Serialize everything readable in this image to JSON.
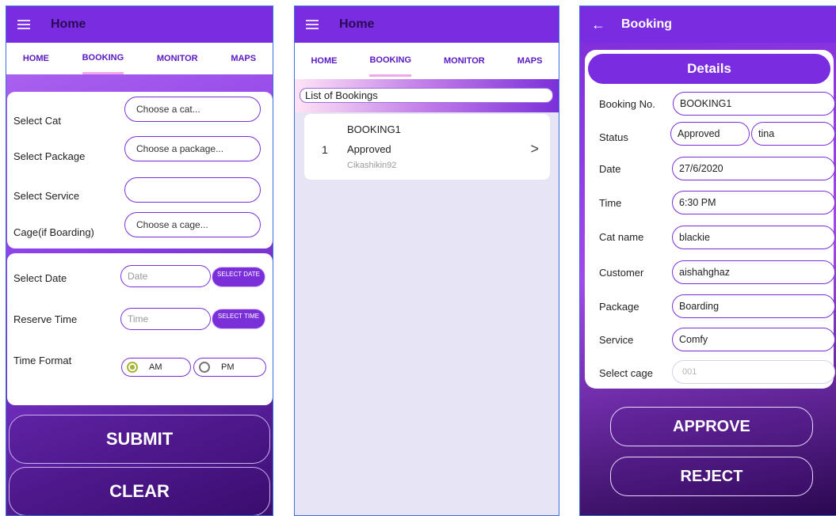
{
  "screen1": {
    "appbar": {
      "title": "Home"
    },
    "tabs": [
      "HOME",
      "BOOKING",
      "MONITOR",
      "MAPS"
    ],
    "active_tab": 1,
    "form": {
      "cat_label": "Select Cat",
      "cat_placeholder": "Choose a cat...",
      "package_label": "Select Package",
      "package_placeholder": "Choose a package...",
      "service_label": "Select Service",
      "service_value": "",
      "cage_label": "Cage(if Boarding)",
      "cage_placeholder": "Choose a cage..."
    },
    "schedule": {
      "date_label": "Select Date",
      "date_placeholder": "Date",
      "select_date_btn": "SELECT DATE",
      "time_label": "Reserve Time",
      "time_placeholder": "Time",
      "select_time_btn": "SELECT TIME",
      "format_label": "Time Format",
      "am_label": "AM",
      "pm_label": "PM",
      "selected_format": "AM"
    },
    "submit_label": "SUBMIT",
    "clear_label": "CLEAR"
  },
  "screen2": {
    "appbar": {
      "title": "Home"
    },
    "tabs": [
      "HOME",
      "BOOKING",
      "MONITOR",
      "MAPS"
    ],
    "active_tab": 1,
    "list_header": "List of Bookings",
    "bookings": [
      {
        "index": "1",
        "booking_no": "BOOKING1",
        "status": "Approved",
        "user": "Cikashikin92"
      }
    ],
    "arrow": ">"
  },
  "screen3": {
    "appbar": {
      "title": "Booking"
    },
    "details_title": "Details",
    "fields": {
      "booking_no_label": "Booking No.",
      "booking_no": "BOOKING1",
      "status_label": "Status",
      "status": "Approved",
      "staff": "tina",
      "date_label": "Date",
      "date": "27/6/2020",
      "time_label": "Time",
      "time": "6:30 PM",
      "cat_label": "Cat name",
      "cat": "blackie",
      "customer_label": "Customer",
      "customer": "aishahghaz",
      "package_label": "Package",
      "package": "Boarding",
      "service_label": "Service",
      "service": "Comfy",
      "cage_label": "Select cage",
      "cage_placeholder": "001"
    },
    "approve_label": "APPROVE",
    "reject_label": "REJECT"
  },
  "colors": {
    "primary": "#7a2ce0",
    "accent": "#7b2fd9",
    "radio_selected": "#a7b43a"
  }
}
